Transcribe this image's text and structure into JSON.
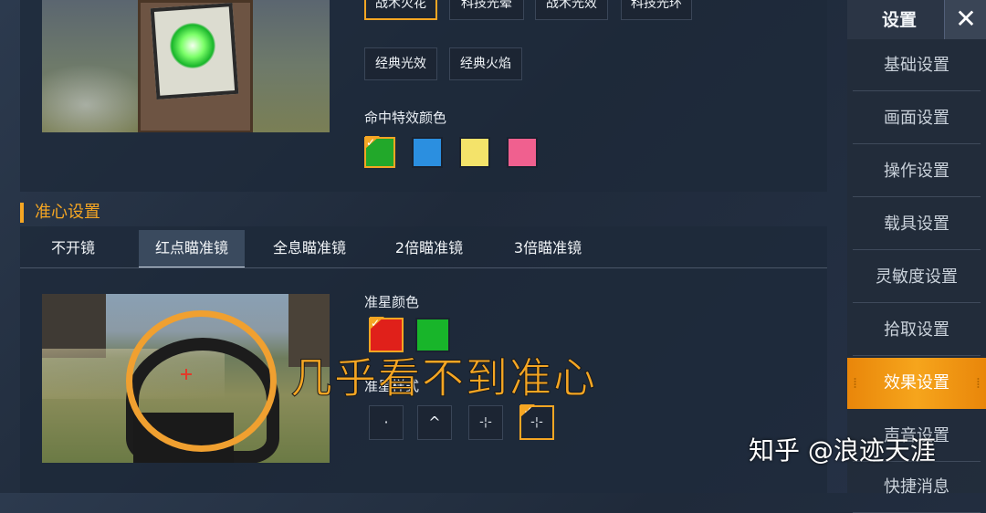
{
  "effects": {
    "top_buttons": [
      "战术火花",
      "科技光晕",
      "战术光效",
      "科技光环"
    ],
    "mid_buttons": [
      "经典光效",
      "经典火焰"
    ],
    "hit_color_label": "命中特效颜色",
    "hit_colors": [
      "#22a82a",
      "#2b8fe0",
      "#f4e36a",
      "#f0608f"
    ],
    "hit_color_selected_index": 0
  },
  "reticle": {
    "section_title": "准心设置",
    "tabs": [
      "不开镜",
      "红点瞄准镜",
      "全息瞄准镜",
      "2倍瞄准镜",
      "3倍瞄准镜"
    ],
    "active_tab_index": 1,
    "color_label": "准星颜色",
    "colors": [
      "#e0201a",
      "#18b52a"
    ],
    "color_selected_index": 0,
    "style_label": "准星样式",
    "styles": [
      "·",
      "^",
      "-¦-",
      "-¦-"
    ],
    "style_selected_index": 3
  },
  "sidebar": {
    "title": "设置",
    "close": "✕",
    "items": [
      "基础设置",
      "画面设置",
      "操作设置",
      "载具设置",
      "灵敏度设置",
      "拾取设置",
      "效果设置",
      "声音设置",
      "快捷消息"
    ],
    "active_index": 6
  },
  "annotation": "几乎看不到准心",
  "watermark": "知乎 @浪迹天涯"
}
